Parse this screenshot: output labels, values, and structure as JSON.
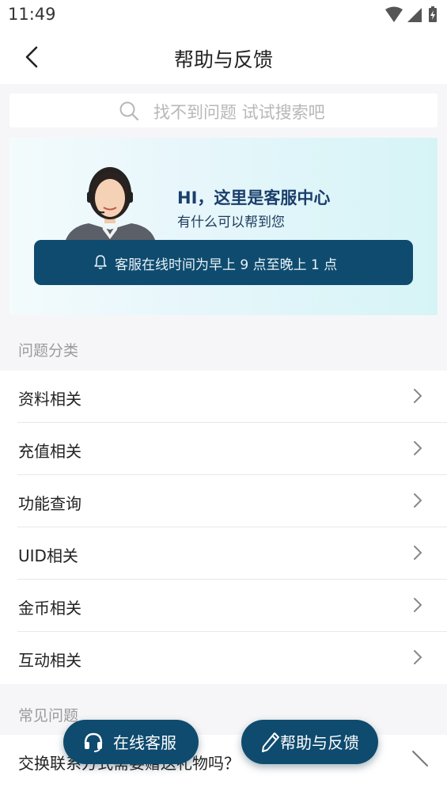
{
  "status_bar": {
    "time": "11:49"
  },
  "nav": {
    "title": "帮助与反馈"
  },
  "search": {
    "placeholder": "找不到问题 试试搜索吧"
  },
  "banner": {
    "greeting": "HI，这里是客服中心",
    "subtitle": "有什么可以帮到您",
    "notice": "客服在线时间为早上 9 点至晚上 1 点"
  },
  "categories": {
    "title": "问题分类",
    "items": [
      {
        "label": "资料相关"
      },
      {
        "label": "充值相关"
      },
      {
        "label": "功能查询"
      },
      {
        "label": "UID相关"
      },
      {
        "label": "金币相关"
      },
      {
        "label": "互动相关"
      }
    ]
  },
  "faq": {
    "title": "常见问题",
    "items": [
      {
        "label": "交换联系方式需要赠送礼物吗？"
      }
    ]
  },
  "fabs": {
    "online_service": "在线客服",
    "help_feedback": "帮助与反馈"
  },
  "colors": {
    "accent": "#0f4b6e",
    "background": "#f6f6f8"
  }
}
